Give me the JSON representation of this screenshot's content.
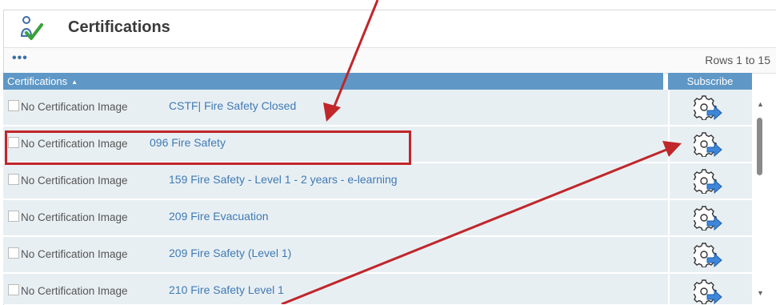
{
  "panel": {
    "title": "Certifications",
    "header_icon": "certification-person-check-icon"
  },
  "toolbar": {
    "menu_label": "•••",
    "rows_info": "Rows 1 to 15"
  },
  "columns": {
    "certifications": "Certifications",
    "sort_icon": "▲",
    "subscribe": "Subscribe"
  },
  "rows": [
    {
      "image_alt": "No Certification Image",
      "name": "CSTF| Fire Safety Closed",
      "subscribe_icon": "subscribe-gear-arrow-icon"
    },
    {
      "image_alt": "No Certification Image",
      "name": "096 Fire Safety",
      "subscribe_icon": "subscribe-gear-arrow-icon"
    },
    {
      "image_alt": "No Certification Image",
      "name": "159 Fire Safety - Level 1 - 2 years - e-learning",
      "subscribe_icon": "subscribe-gear-arrow-icon"
    },
    {
      "image_alt": "No Certification Image",
      "name": "209 Fire Evacuation",
      "subscribe_icon": "subscribe-gear-arrow-icon"
    },
    {
      "image_alt": "No Certification Image",
      "name": "209 Fire Safety (Level 1)",
      "subscribe_icon": "subscribe-gear-arrow-icon"
    },
    {
      "image_alt": "No Certification Image",
      "name": "210 Fire Safety Level 1",
      "subscribe_icon": "subscribe-gear-arrow-icon"
    }
  ],
  "scrollbar": {
    "up_arrow": "▲",
    "down_arrow": "▼"
  },
  "annotations": {
    "color": "#c0262a"
  },
  "colors": {
    "header_blue": "#5f98c7",
    "row_bg": "#e8eff3",
    "link": "#3f7ab4"
  }
}
